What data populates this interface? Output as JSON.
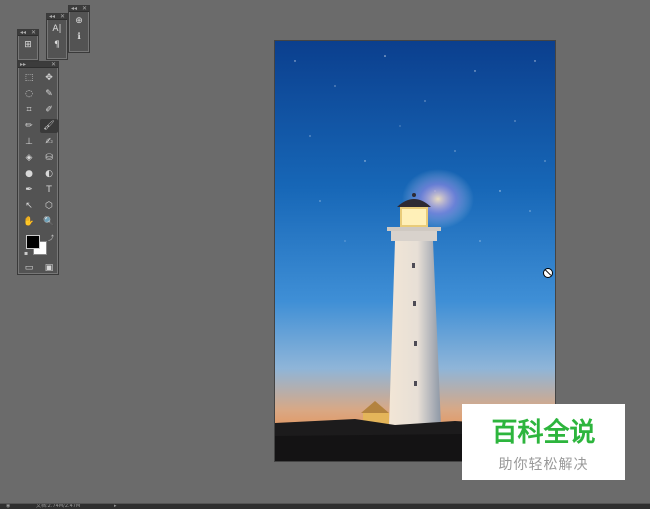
{
  "panels": {
    "small_a": {
      "buttons": [
        "⊞",
        "¶"
      ]
    },
    "small_b": {
      "buttons": [
        "A|",
        "¶"
      ]
    },
    "small_c": {
      "buttons": [
        "⊕",
        "ℹ"
      ]
    }
  },
  "tools": [
    [
      "⬚",
      "✥"
    ],
    [
      "◌",
      "✎"
    ],
    [
      "⌗",
      "✐"
    ],
    [
      "✏",
      "🖌"
    ],
    [
      "⊥",
      "✍"
    ],
    [
      "◈",
      "⛁"
    ],
    [
      "●",
      "◐"
    ],
    [
      "✒",
      "T"
    ],
    [
      "↖",
      "⬡"
    ],
    [
      "✋",
      "🔍"
    ]
  ],
  "bottom_icons": [
    "▭",
    "▣"
  ],
  "watermark": {
    "title": "百科全说",
    "subtitle": "助你轻松解决"
  },
  "status": {
    "left_icon": "◉",
    "doc_info": "文档:2.74M/2.47M",
    "arrow": "▸"
  },
  "colors": {
    "foreground": "#000000",
    "background": "#ffffff",
    "watermark_green": "#2db53d"
  }
}
